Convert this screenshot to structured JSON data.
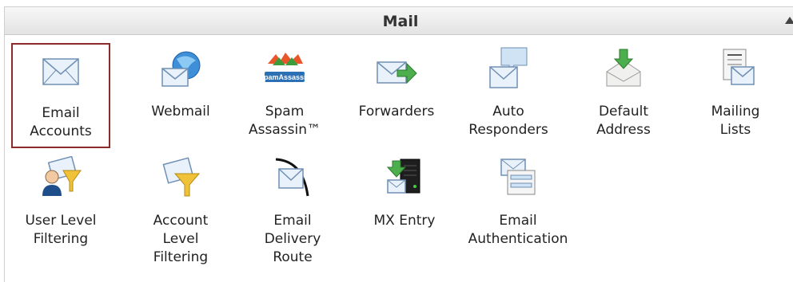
{
  "panel": {
    "title": "Mail"
  },
  "items": [
    {
      "label": "Email\nAccounts",
      "icon": "envelope-icon"
    },
    {
      "label": "Webmail",
      "icon": "globe-envelope-icon"
    },
    {
      "label": "Spam\nAssassin™",
      "icon": "spamassassin-icon",
      "logo_text": "SpamAssassin"
    },
    {
      "label": "Forwarders",
      "icon": "envelope-arrow-icon"
    },
    {
      "label": "Auto\nResponders",
      "icon": "envelope-speech-icon"
    },
    {
      "label": "Default\nAddress",
      "icon": "envelope-download-icon"
    },
    {
      "label": "Mailing\nLists",
      "icon": "list-envelope-icon"
    },
    {
      "label": "User Level\nFiltering",
      "icon": "user-filter-icon"
    },
    {
      "label": "Account\nLevel\nFiltering",
      "icon": "envelope-filter-icon"
    },
    {
      "label": "Email\nDelivery\nRoute",
      "icon": "envelope-route-icon"
    },
    {
      "label": "MX Entry",
      "icon": "server-envelope-icon"
    },
    {
      "label": "Email\nAuthentication",
      "icon": "envelope-form-icon"
    }
  ],
  "colors": {
    "selected_border": "#8b2b2b",
    "header_text": "#333333"
  }
}
